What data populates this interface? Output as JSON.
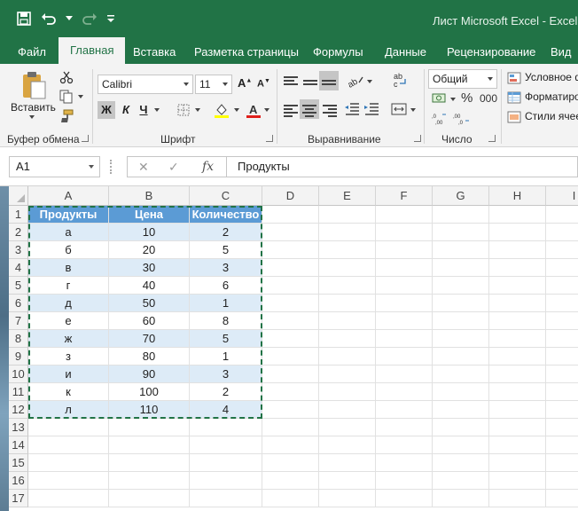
{
  "window": {
    "title": "Лист Microsoft Excel  -  Excel"
  },
  "qat": {
    "save_icon": "save-icon",
    "undo_icon": "undo-icon",
    "redo_icon": "redo-icon",
    "customize_icon": "customize-qat-icon"
  },
  "tabs": [
    {
      "label": "Файл"
    },
    {
      "label": "Главная"
    },
    {
      "label": "Вставка"
    },
    {
      "label": "Разметка страницы"
    },
    {
      "label": "Формулы"
    },
    {
      "label": "Данные"
    },
    {
      "label": "Рецензирование"
    },
    {
      "label": "Вид"
    }
  ],
  "ribbon": {
    "clipboard": {
      "paste_label": "Вставить",
      "group_label": "Буфер обмена"
    },
    "font": {
      "name": "Calibri",
      "size": "11",
      "bold": "Ж",
      "italic": "К",
      "underline": "Ч",
      "group_label": "Шрифт"
    },
    "alignment": {
      "group_label": "Выравнивание"
    },
    "number": {
      "format": "Общий",
      "group_label": "Число",
      "percent": "%",
      "comma": "000"
    },
    "styles": {
      "conditional": "Условное фо",
      "format_table": "Форматиро",
      "cell_styles": "Стили ячеек"
    }
  },
  "formula_bar": {
    "name_box": "A1",
    "cancel": "✕",
    "enter": "✓",
    "fx": "fx",
    "content": "Продукты"
  },
  "columns": [
    "A",
    "B",
    "C",
    "D",
    "E",
    "F",
    "G",
    "H",
    "I"
  ],
  "rows": [
    "1",
    "2",
    "3",
    "4",
    "5",
    "6",
    "7",
    "8",
    "9",
    "10",
    "11",
    "12",
    "13",
    "14",
    "15",
    "16",
    "17"
  ],
  "table": {
    "headers": [
      "Продукты",
      "Цена",
      "Количество"
    ],
    "rows": [
      [
        "а",
        "10",
        "2"
      ],
      [
        "б",
        "20",
        "5"
      ],
      [
        "в",
        "30",
        "3"
      ],
      [
        "г",
        "40",
        "6"
      ],
      [
        "д",
        "50",
        "1"
      ],
      [
        "е",
        "60",
        "8"
      ],
      [
        "ж",
        "70",
        "5"
      ],
      [
        "з",
        "80",
        "1"
      ],
      [
        "и",
        "90",
        "3"
      ],
      [
        "к",
        "100",
        "2"
      ],
      [
        "л",
        "110",
        "4"
      ]
    ]
  },
  "colors": {
    "brand": "#217346",
    "table_header": "#5b9bd5",
    "table_band": "#ddebf7",
    "selection_marquee": "#217346"
  }
}
